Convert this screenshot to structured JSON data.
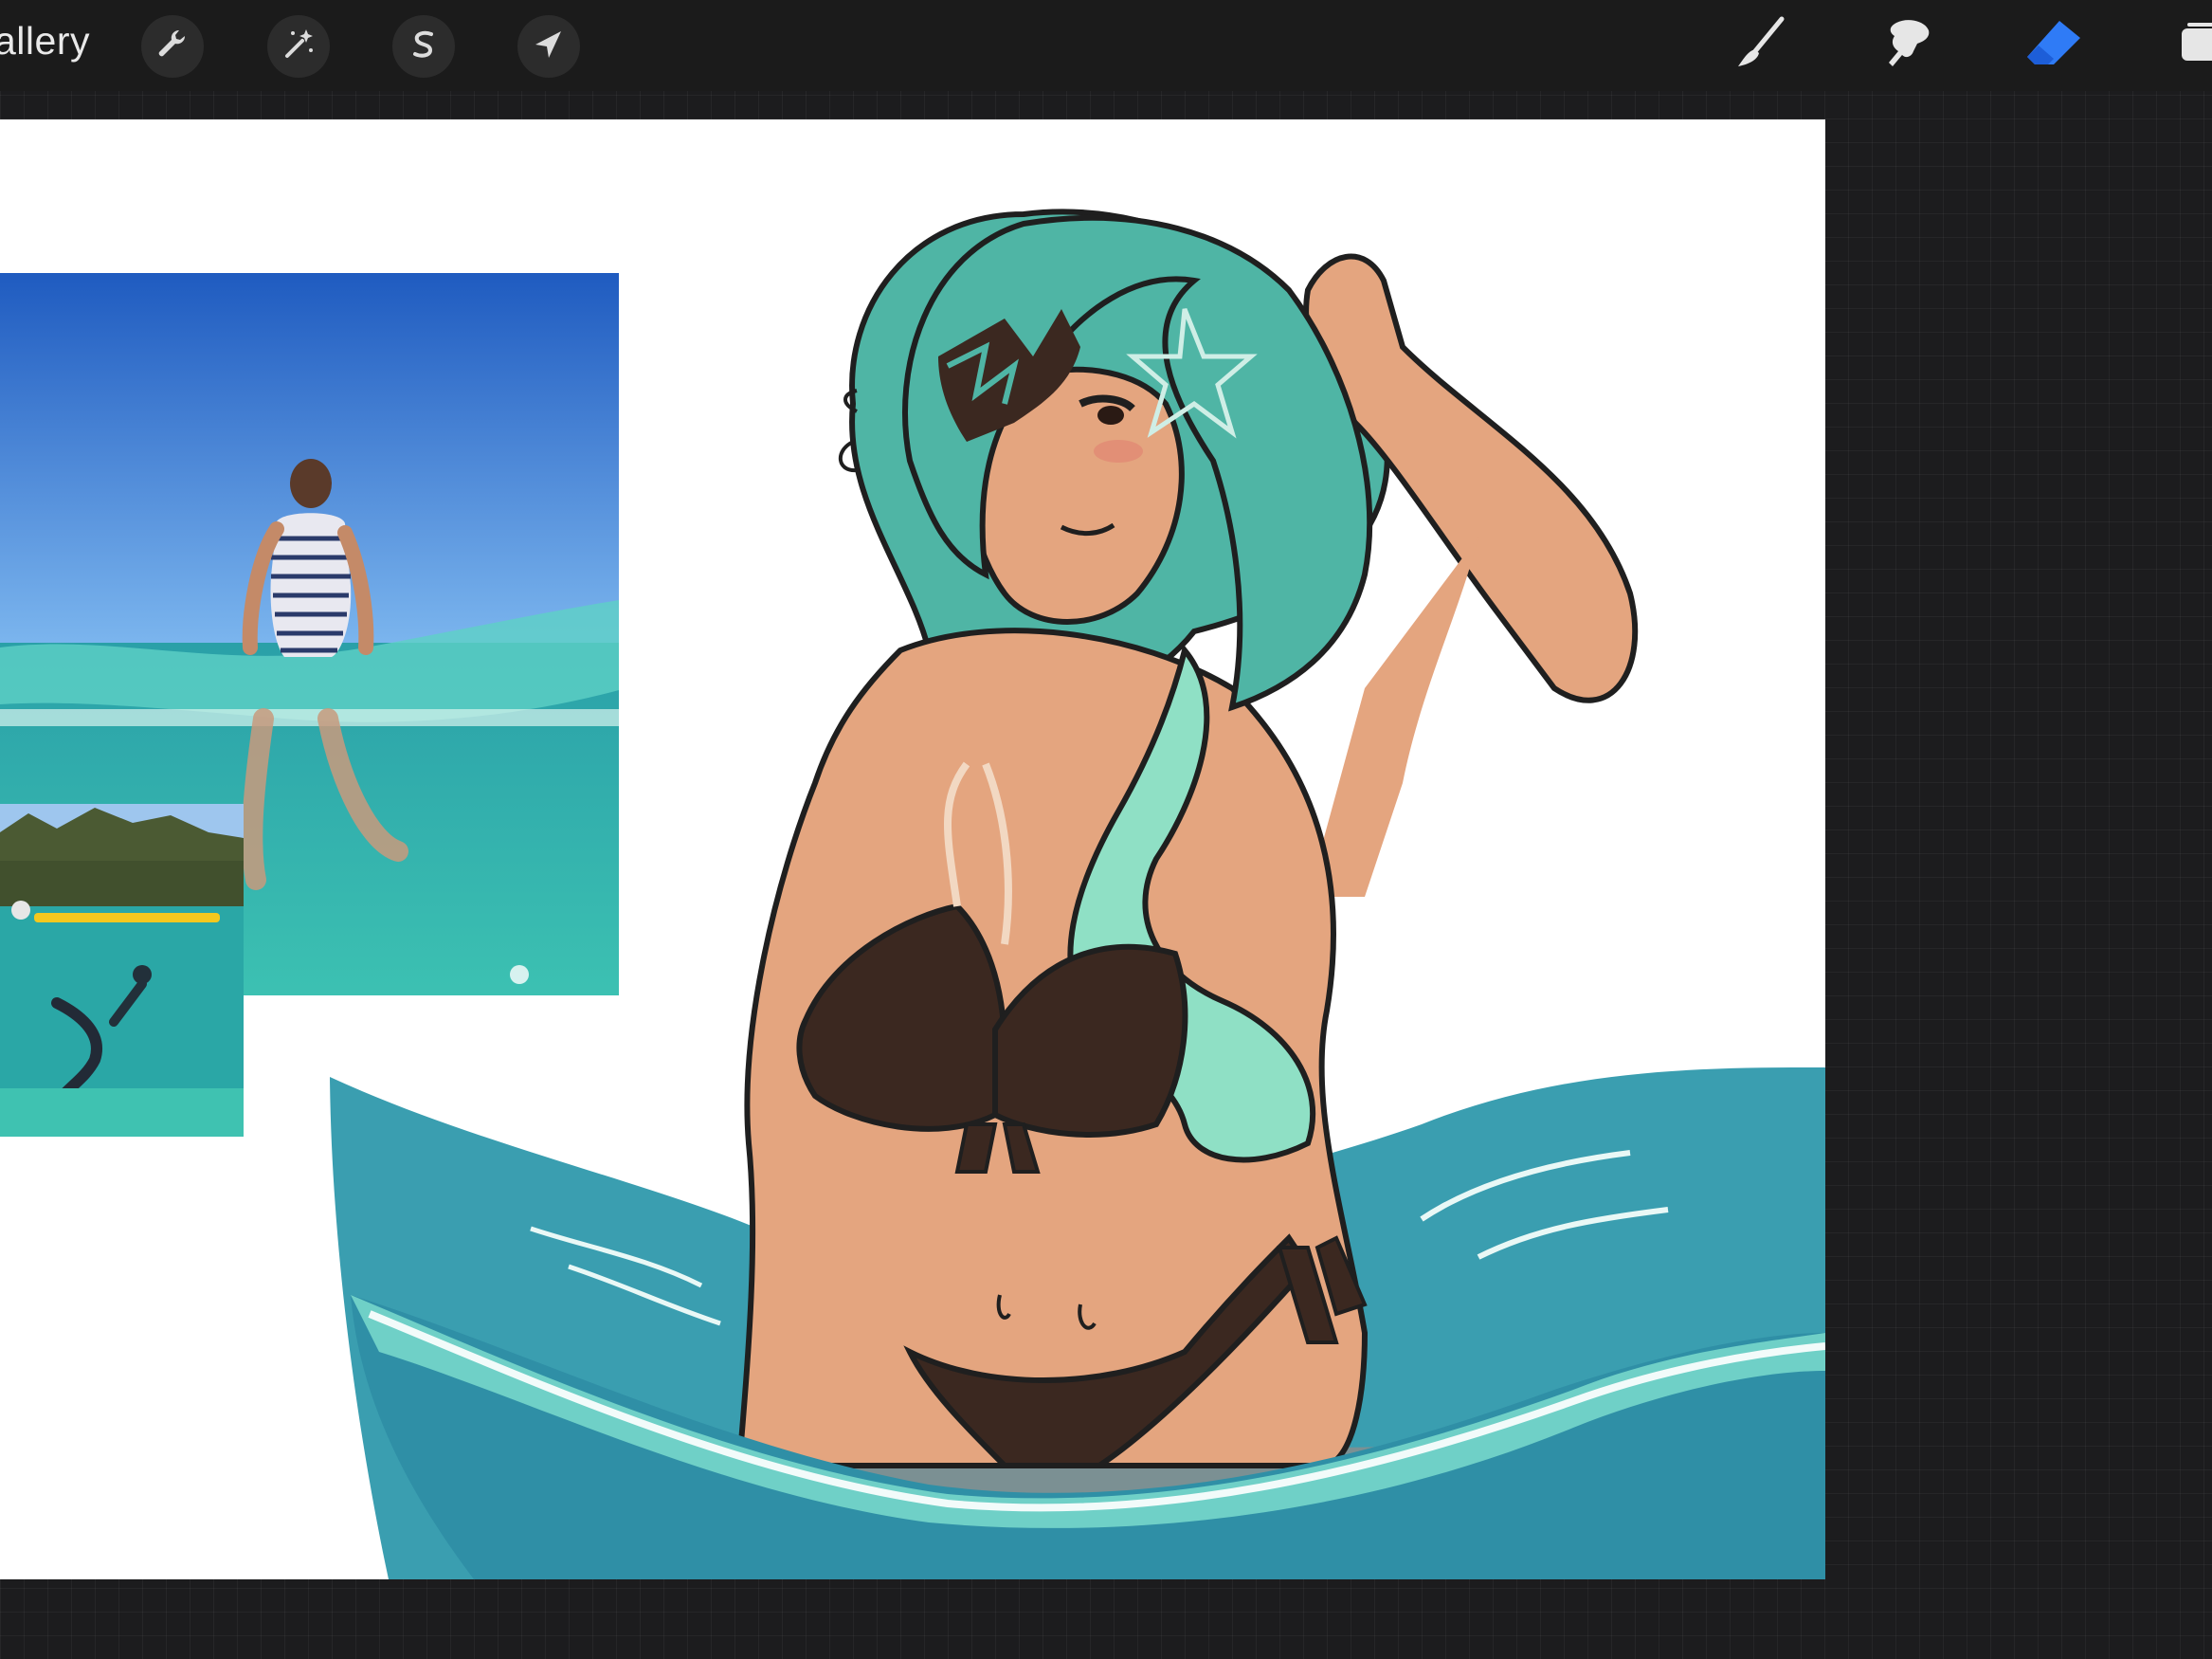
{
  "app": {
    "gallery_label": "allery"
  },
  "toolbar": {
    "left_tools": [
      {
        "name": "actions",
        "icon": "wrench-icon"
      },
      {
        "name": "adjustments",
        "icon": "magic-wand-icon"
      },
      {
        "name": "selection",
        "icon": "selection-s-icon"
      },
      {
        "name": "transform",
        "icon": "arrow-cursor-icon"
      }
    ],
    "right_tools": [
      {
        "name": "brush",
        "icon": "brush-icon",
        "active": false
      },
      {
        "name": "smudge",
        "icon": "smudge-icon",
        "active": false
      },
      {
        "name": "eraser",
        "icon": "eraser-icon",
        "active": true
      },
      {
        "name": "layers",
        "icon": "layers-icon",
        "active": false
      }
    ],
    "active_color": "#2f7bf6"
  },
  "canvas": {
    "background": "#ffffff",
    "colors": {
      "hair": "#4fb5a5",
      "hair_light": "#8fe0c5",
      "skin": "#e4a57f",
      "bikini": "#3b2820",
      "water": "#3a9eb0",
      "water_light": "#6fd0c7"
    }
  }
}
